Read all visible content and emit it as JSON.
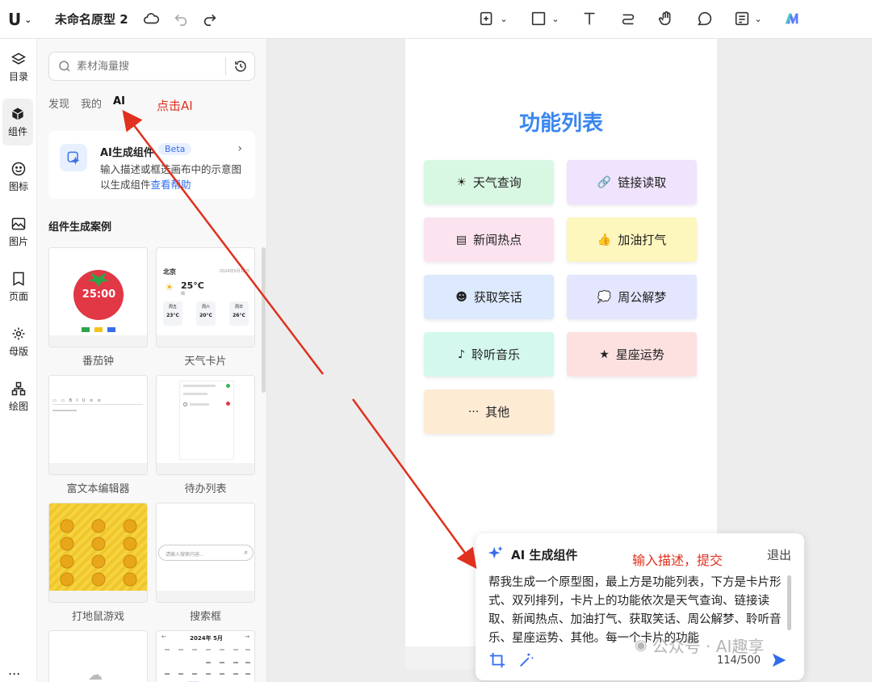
{
  "header": {
    "doc_title": "未命名原型 2",
    "logo_text": "U"
  },
  "rail": {
    "items": [
      {
        "label": "目录",
        "icon": "layers-icon"
      },
      {
        "label": "组件",
        "icon": "component-icon"
      },
      {
        "label": "图标",
        "icon": "smile-icon"
      },
      {
        "label": "图片",
        "icon": "image-icon"
      },
      {
        "label": "页面",
        "icon": "page-icon"
      },
      {
        "label": "母版",
        "icon": "master-icon"
      },
      {
        "label": "绘图",
        "icon": "diagram-icon"
      }
    ],
    "more": "..."
  },
  "panel": {
    "search_placeholder": "素材海量搜",
    "tabs": [
      "发现",
      "我的",
      "AI"
    ],
    "annotation_click": "点击AI",
    "ai_card": {
      "title": "AI生成组件",
      "badge": "Beta",
      "desc": "输入描述或框选画布中的示意图以生成组件",
      "help": "查看帮助"
    },
    "section_title": "组件生成案例",
    "cases": [
      "番茄钟",
      "天气卡片",
      "富文本编辑器",
      "待办列表",
      "打地鼠游戏",
      "搜索框"
    ],
    "case_details": {
      "tomato_time": "25:00",
      "weather_city": "北京",
      "weather_date": "2024年5月18日",
      "weather_temp": "25°C",
      "weather_cond": "晴",
      "weather_days": [
        "周五",
        "周六",
        "周日"
      ],
      "weather_temps": [
        "23°C",
        "20°C",
        "26°C"
      ],
      "search_placeholder": "请输入搜索内容...",
      "calendar_title": "2024年 5月"
    }
  },
  "canvas": {
    "frame_title": "功能列表",
    "cards": [
      {
        "label": "天气查询",
        "glyph": "☀",
        "bg": "#d9f8e4"
      },
      {
        "label": "链接读取",
        "glyph": "🔗",
        "bg": "#efe3fd"
      },
      {
        "label": "新闻热点",
        "glyph": "▤",
        "bg": "#fce3f0"
      },
      {
        "label": "加油打气",
        "glyph": "👍",
        "bg": "#fdf6bd"
      },
      {
        "label": "获取笑话",
        "glyph": "☻",
        "bg": "#dde9fd"
      },
      {
        "label": "周公解梦",
        "glyph": "💭",
        "bg": "#e3e6fd"
      },
      {
        "label": "聆听音乐",
        "glyph": "♪",
        "bg": "#d4f8ee"
      },
      {
        "label": "星座运势",
        "glyph": "★",
        "bg": "#fde1e1"
      },
      {
        "label": "其他",
        "glyph": "···",
        "bg": "#fdebd4"
      }
    ]
  },
  "dialog": {
    "title": "AI 生成组件",
    "annotation": "输入描述，提交",
    "exit": "退出",
    "text": "帮我生成一个原型图，最上方是功能列表，下方是卡片形式、双列排列，卡片上的功能依次是天气查询、链接读取、新闻热点、加油打气、获取笑话、周公解梦、聆听音乐、星座运势、其他。每一个卡片的功能",
    "count": "114/500"
  },
  "watermark": "公众号 · AI趣享",
  "colors": {
    "accent": "#3a86f0",
    "annotation": "#e0301e",
    "link": "#2f6cf0"
  }
}
